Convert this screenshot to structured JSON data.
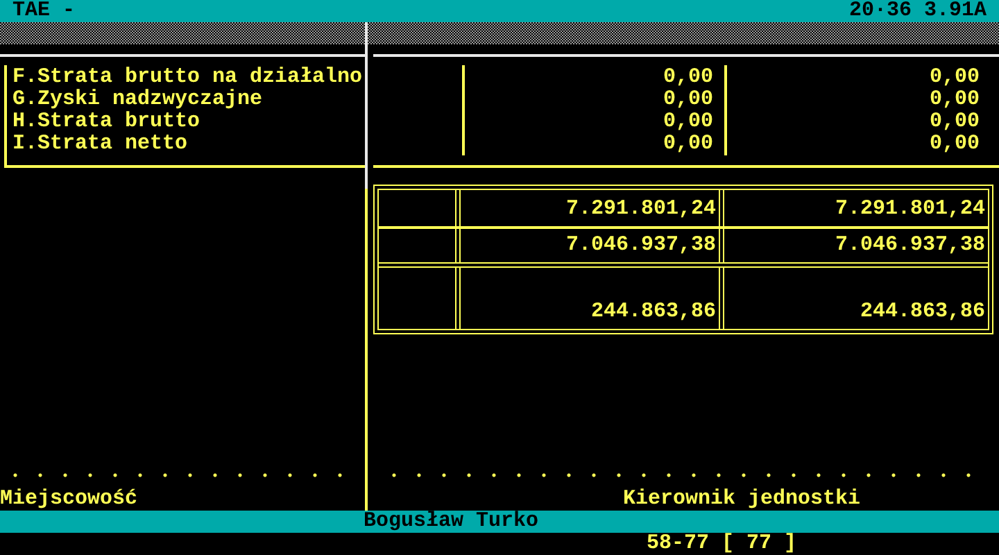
{
  "title_bar": {
    "title": "TAE -",
    "status": "20·36 3.91A"
  },
  "items": [
    {
      "label": "F.Strata brutto na działalno",
      "value_1": "0,00",
      "value_2": "0,00"
    },
    {
      "label": "G.Zyski nadzwyczajne",
      "value_1": "0,00",
      "value_2": "0,00"
    },
    {
      "label": "H.Strata brutto",
      "value_1": "0,00",
      "value_2": "0,00"
    },
    {
      "label": "I.Strata netto",
      "value_1": "0,00",
      "value_2": "0,00"
    }
  ],
  "totals": [
    {
      "value_1": "7.291.801,24",
      "value_2": "7.291.801,24"
    },
    {
      "value_1": "7.046.937,38",
      "value_2": "7.046.937,38"
    },
    {
      "value_1": "244.863,86",
      "value_2": "244.863,86"
    }
  ],
  "signature": {
    "place_label": "Miejscowość",
    "manager_label": "Kierownik jednostki"
  },
  "status_bar": {
    "user": "Bogusław Turko",
    "position": "58-77 [ 77 ]"
  }
}
